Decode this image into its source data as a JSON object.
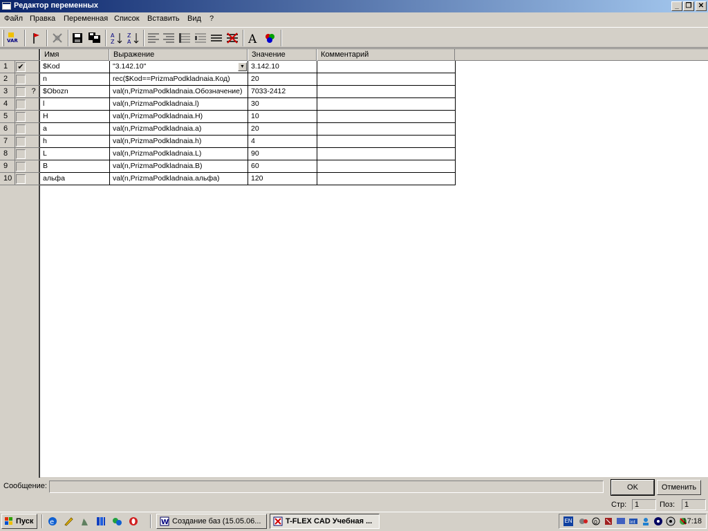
{
  "window": {
    "title": "Редактор переменных"
  },
  "menu": [
    "Файл",
    "Правка",
    "Переменная",
    "Список",
    "Вставить",
    "Вид",
    "?"
  ],
  "toolbar": {
    "var_label": "VAR",
    "icons": [
      "var-icon",
      "flag-icon",
      "delete-icon",
      "save-icon",
      "save-all-icon",
      "sort-asc-icon",
      "sort-desc-icon",
      "align-left-icon",
      "align-indent-icon",
      "list-icon",
      "list-indent-icon",
      "lines-icon",
      "strike-lines-icon",
      "font-icon",
      "color-icon"
    ],
    "font_glyph": "A"
  },
  "table": {
    "columns": [
      "Имя",
      "Выражение",
      "Значение",
      "Комментарий"
    ],
    "rows": [
      {
        "num": "1",
        "checked": "✔",
        "flag": "",
        "name": "$Kod",
        "expr": "\"3.142.10\"",
        "value": "3.142.10",
        "comment": ""
      },
      {
        "num": "2",
        "checked": "",
        "flag": "",
        "name": "n",
        "expr": "rec($Kod==PrizmaPodkladnaia.Код)",
        "value": "20",
        "comment": ""
      },
      {
        "num": "3",
        "checked": "",
        "flag": "?",
        "name": "$Obozn",
        "expr": "val(n,PrizmaPodkladnaia.Обозначение)",
        "value": "7033-2412",
        "comment": ""
      },
      {
        "num": "4",
        "checked": "",
        "flag": "",
        "name": "l",
        "expr": "val(n,PrizmaPodkladnaia.l)",
        "value": "30",
        "comment": ""
      },
      {
        "num": "5",
        "checked": "",
        "flag": "",
        "name": "H",
        "expr": "val(n,PrizmaPodkladnaia.H)",
        "value": "10",
        "comment": ""
      },
      {
        "num": "6",
        "checked": "",
        "flag": "",
        "name": "a",
        "expr": "val(n,PrizmaPodkladnaia.a)",
        "value": "20",
        "comment": ""
      },
      {
        "num": "7",
        "checked": "",
        "flag": "",
        "name": "h",
        "expr": "val(n,PrizmaPodkladnaia.h)",
        "value": "4",
        "comment": ""
      },
      {
        "num": "8",
        "checked": "",
        "flag": "",
        "name": "L",
        "expr": "val(n,PrizmaPodkladnaia.L)",
        "value": "90",
        "comment": ""
      },
      {
        "num": "9",
        "checked": "",
        "flag": "",
        "name": "B",
        "expr": "val(n,PrizmaPodkladnaia.B)",
        "value": "60",
        "comment": ""
      },
      {
        "num": "10",
        "checked": "",
        "flag": "",
        "name": "альфа",
        "expr": "val(n,PrizmaPodkladnaia.альфа)",
        "value": "120",
        "comment": ""
      }
    ]
  },
  "footer": {
    "message_label": "Сообщение:",
    "message_value": "",
    "ok_label": "OK",
    "cancel_label": "Отменить",
    "page_label": "Стр:",
    "page_value": "1",
    "pos_label": "Поз:",
    "pos_value": "1"
  },
  "taskbar": {
    "start_label": "Пуск",
    "tasks": [
      {
        "label": "Создание баз (15.05.06...",
        "icon": "word-icon",
        "active": false
      },
      {
        "label": "T-FLEX CAD Учебная ...",
        "icon": "tflex-icon",
        "active": true
      }
    ],
    "lang": "EN",
    "clock": "17:18"
  },
  "colors": {
    "titlebar_start": "#0a246a",
    "titlebar_end": "#a6caf0",
    "face": "#d4d0c8"
  }
}
